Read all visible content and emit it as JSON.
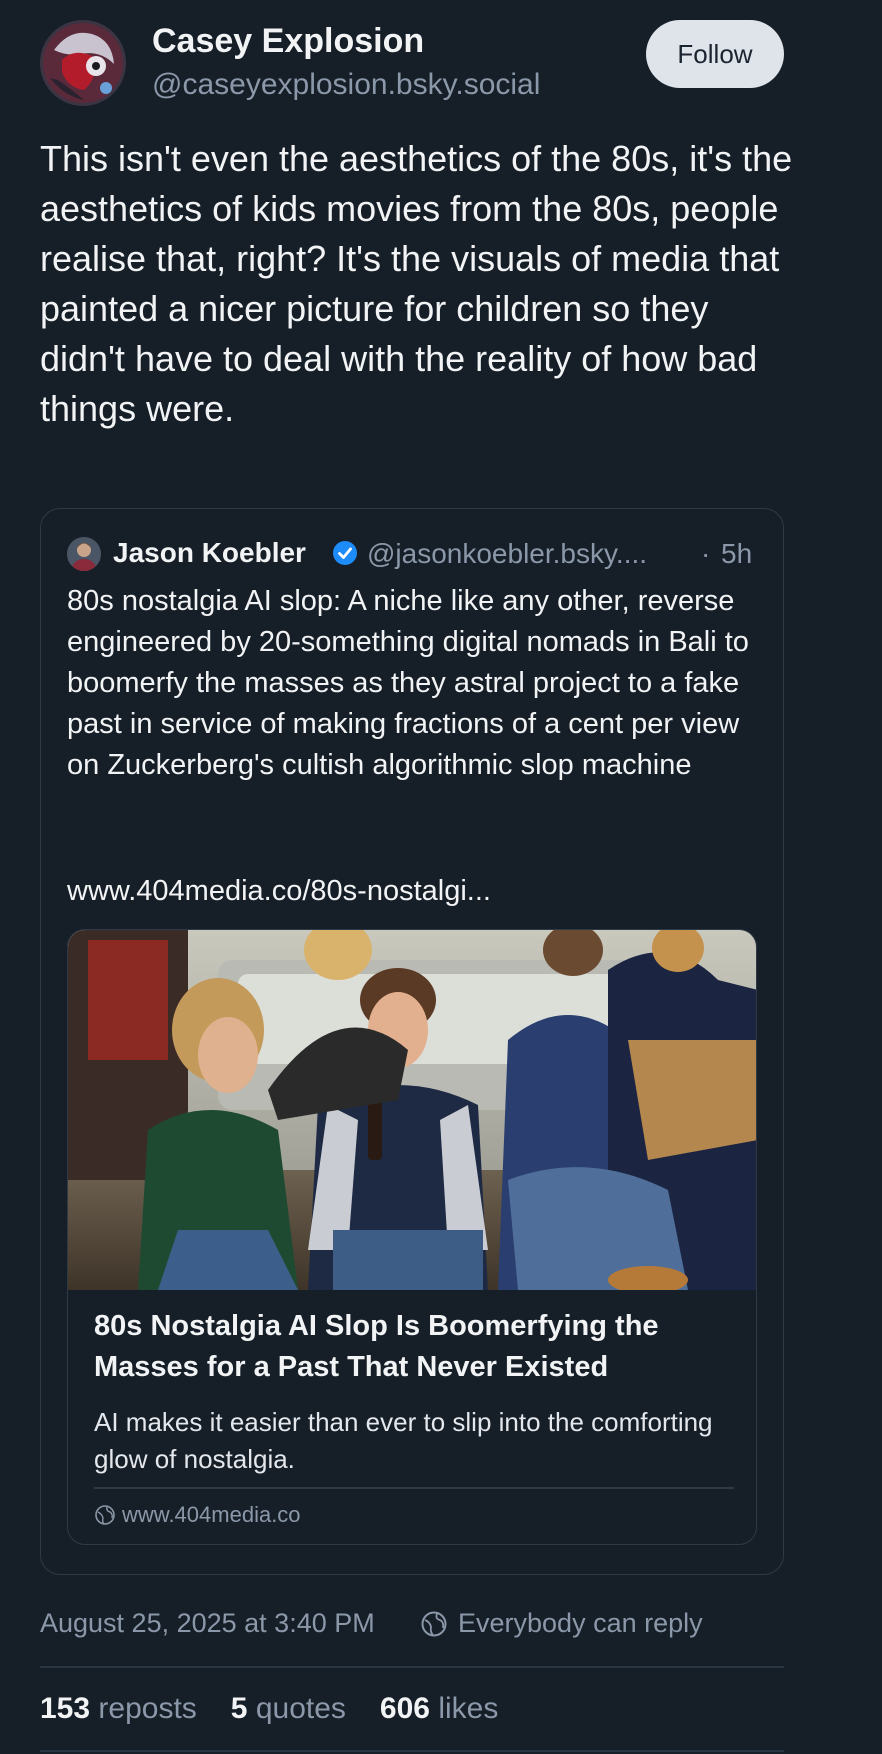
{
  "author": {
    "display_name": "Casey Explosion",
    "handle": "@caseyexplosion.bsky.social",
    "avatar_icon": "user-avatar"
  },
  "follow_label": "Follow",
  "post_text": "This isn't even the aesthetics of the 80s, it's the aesthetics of kids movies from the 80s, people realise that, right? It's the visuals of media that painted a nicer picture for children so they didn't have to deal with the reality of how bad things were.",
  "quote": {
    "display_name": "Jason Koebler",
    "verified_icon": "verified-check-icon",
    "handle": "@jasonkoebler.bsky....",
    "separator": "·",
    "time": "5h",
    "text": "80s nostalgia AI slop: A niche like any other, reverse engineered by 20-something digital nomads in Bali to boomerfy the masses as they astral project to a fake past in service of making fractions of a cent per view on Zuckerberg's cultish algorithmic slop machine",
    "link_text": "www.404media.co/80s-nostalgi...",
    "embed": {
      "title": "80s Nostalgia AI Slop Is Boomerfying the Masses for a Past That Never Existed",
      "description": "AI makes it easier than ever to slip into the comforting glow of nostalgia.",
      "domain": "www.404media.co",
      "domain_icon": "globe-icon"
    }
  },
  "timestamp": "August 25, 2025 at 3:40 PM",
  "reply_setting": "Everybody can reply",
  "stats": {
    "reposts_num": "153",
    "reposts_label": "reposts",
    "quotes_num": "5",
    "quotes_label": "quotes",
    "likes_num": "606",
    "likes_label": "likes"
  },
  "colors": {
    "background": "#161e27",
    "text_primary": "#f1f3f5",
    "text_secondary": "#8b98a9",
    "verified": "#1d8cf8",
    "follow_button": "#dfe4ea"
  }
}
